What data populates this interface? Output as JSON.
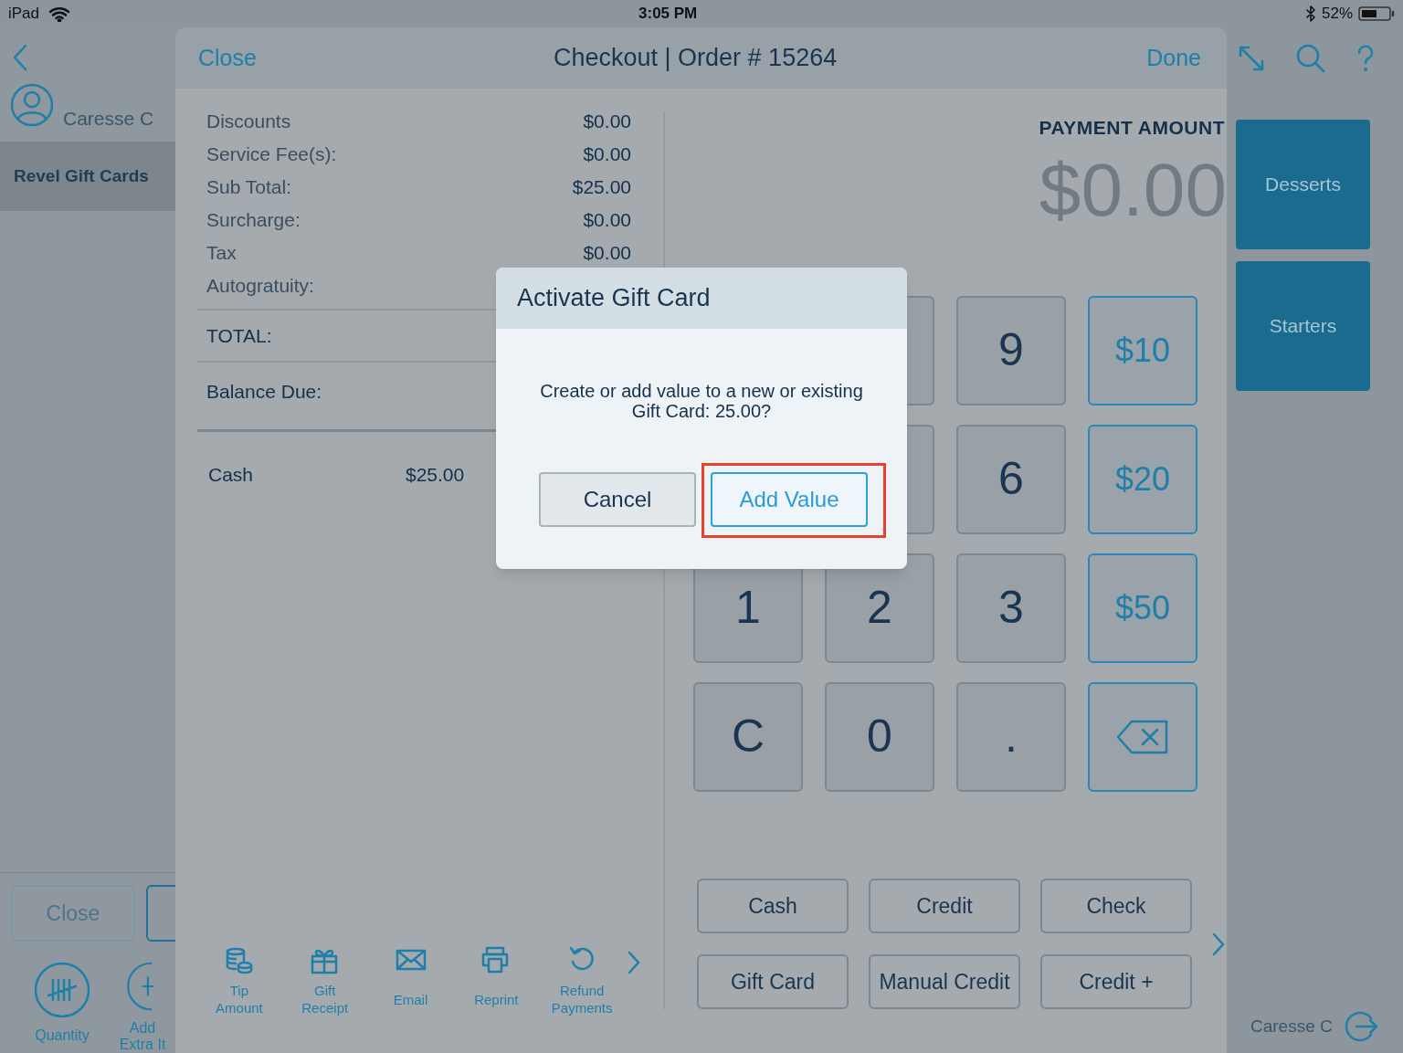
{
  "status_bar": {
    "device": "iPad",
    "time": "3:05 PM",
    "battery": "52%"
  },
  "sidebar": {
    "user": "Caresse C",
    "items": [
      {
        "label": "Revel Gift Cards",
        "selected": true
      }
    ],
    "close_button": "Close",
    "actions": [
      {
        "label": "Quantity"
      },
      {
        "label": "Add Extra It"
      }
    ]
  },
  "checkout": {
    "close": "Close",
    "title": "Checkout | Order # 15264",
    "done": "Done",
    "summary": [
      {
        "label": "Discounts",
        "value": "$0.00",
        "kind": "line"
      },
      {
        "label": "Service Fee(s):",
        "value": "$0.00",
        "kind": "line"
      },
      {
        "label": "Sub Total:",
        "value": "$25.00",
        "kind": "line"
      },
      {
        "label": "Surcharge:",
        "value": "$0.00",
        "kind": "line"
      },
      {
        "label": "Tax",
        "value": "$0.00",
        "kind": "line"
      },
      {
        "label": "Autogratuity:",
        "kind": "line"
      },
      {
        "label": "TOTAL:",
        "kind": "total"
      },
      {
        "label": "Balance Due:",
        "kind": "balance"
      }
    ],
    "payments": [
      {
        "method": "Cash",
        "amount": "$25.00"
      }
    ],
    "toolbar": [
      {
        "label": "Tip Amount"
      },
      {
        "label": "Gift Receipt"
      },
      {
        "label": "Email"
      },
      {
        "label": "Reprint"
      },
      {
        "label": "Refund Payments"
      }
    ],
    "payment_amount": {
      "label": "PAYMENT AMOUNT",
      "amount": "$0.00"
    },
    "keypad": [
      {
        "kind": "covered"
      },
      {
        "kind": "covered"
      },
      {
        "kind": "digit",
        "label": "9"
      },
      {
        "kind": "amount",
        "label": "$10"
      },
      {
        "kind": "covered"
      },
      {
        "kind": "covered"
      },
      {
        "kind": "digit",
        "label": "6"
      },
      {
        "kind": "amount",
        "label": "$20"
      },
      {
        "kind": "digit",
        "label": "1"
      },
      {
        "kind": "digit",
        "label": "2"
      },
      {
        "kind": "digit",
        "label": "3"
      },
      {
        "kind": "amount",
        "label": "$50"
      },
      {
        "kind": "digit",
        "label": "C"
      },
      {
        "kind": "digit",
        "label": "0"
      },
      {
        "kind": "digit",
        "label": "."
      },
      {
        "kind": "backspace"
      }
    ],
    "methods": [
      "Cash",
      "Credit",
      "Check",
      "Gift Card",
      "Manual Credit",
      "Credit +"
    ]
  },
  "categories": [
    "Desserts",
    "Starters"
  ],
  "footer_user": "Caresse C",
  "dialog": {
    "title": "Activate Gift Card",
    "message": "Create or add value to a new or existing Gift Card: 25.00?",
    "buttons": [
      {
        "label": "Cancel",
        "kind": "secondary",
        "highlighted": false
      },
      {
        "label": "Add Value",
        "kind": "primary",
        "highlighted": true
      }
    ]
  }
}
